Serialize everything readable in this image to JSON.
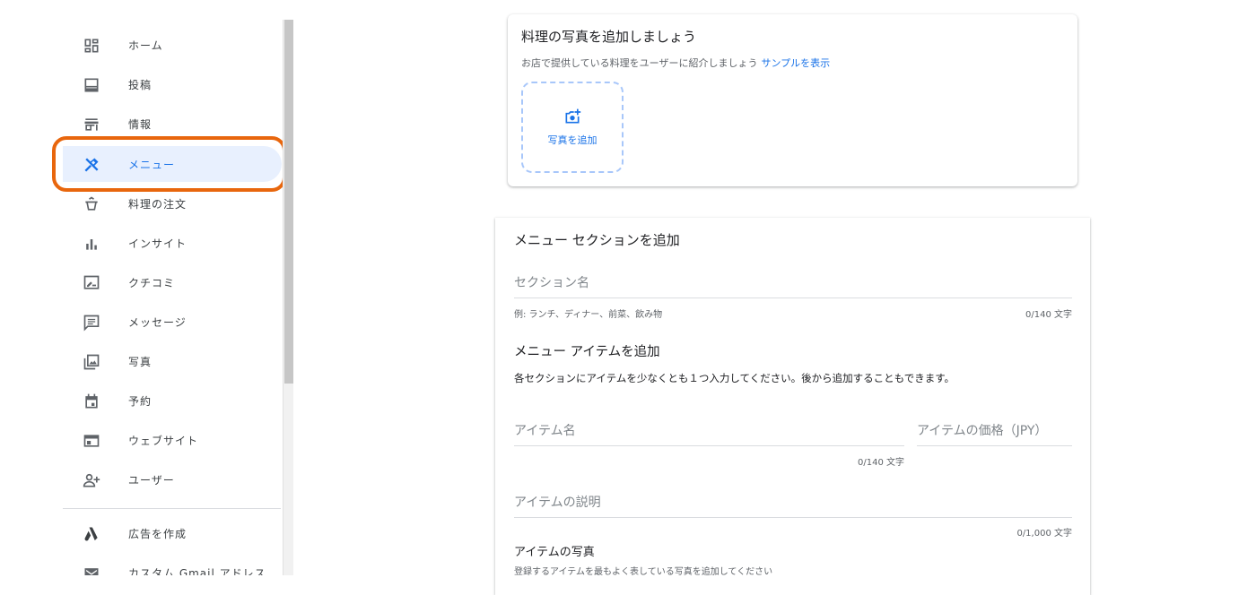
{
  "sidebar": {
    "items": [
      {
        "label": "ホーム",
        "icon": "dashboard-icon"
      },
      {
        "label": "投稿",
        "icon": "posts-icon"
      },
      {
        "label": "情報",
        "icon": "store-icon"
      },
      {
        "label": "メニュー",
        "icon": "restaurant-icon",
        "active": true
      },
      {
        "label": "料理の注文",
        "icon": "order-icon"
      },
      {
        "label": "インサイト",
        "icon": "insights-icon"
      },
      {
        "label": "クチコミ",
        "icon": "reviews-icon"
      },
      {
        "label": "メッセージ",
        "icon": "message-icon"
      },
      {
        "label": "写真",
        "icon": "photo-library-icon"
      },
      {
        "label": "予約",
        "icon": "calendar-icon"
      },
      {
        "label": "ウェブサイト",
        "icon": "website-icon"
      },
      {
        "label": "ユーザー",
        "icon": "add-user-icon"
      },
      {
        "label": "広告を作成",
        "icon": "google-ads-icon"
      },
      {
        "label": "カスタム Gmail アドレス",
        "icon": "mail-icon"
      }
    ]
  },
  "photo_card": {
    "title": "料理の写真を追加しましょう",
    "description": "お店で提供している料理をユーザーに紹介しましょう",
    "sample_link": "サンプルを表示",
    "add_photo_label": "写真を追加"
  },
  "menu_card": {
    "title": "メニュー セクションを追加",
    "section_name_placeholder": "セクション名",
    "section_hint": "例: ランチ、ディナー、前菜、飲み物",
    "section_counter": "0/140 文字",
    "item_heading": "メニュー アイテムを追加",
    "item_note": "各セクションにアイテムを少なくとも１つ入力してください。後から追加することもできます。",
    "item_name_placeholder": "アイテム名",
    "item_name_counter": "0/140 文字",
    "item_price_placeholder": "アイテムの価格（JPY）",
    "item_desc_placeholder": "アイテムの説明",
    "item_desc_counter": "0/1,000 文字",
    "item_photo_heading": "アイテムの写真",
    "item_photo_hint": "登録するアイテムを最もよく表している写真を追加してください"
  },
  "colors": {
    "accent": "#1a73e8",
    "highlight": "#e8660d",
    "active_bg": "#e8f0fe"
  }
}
